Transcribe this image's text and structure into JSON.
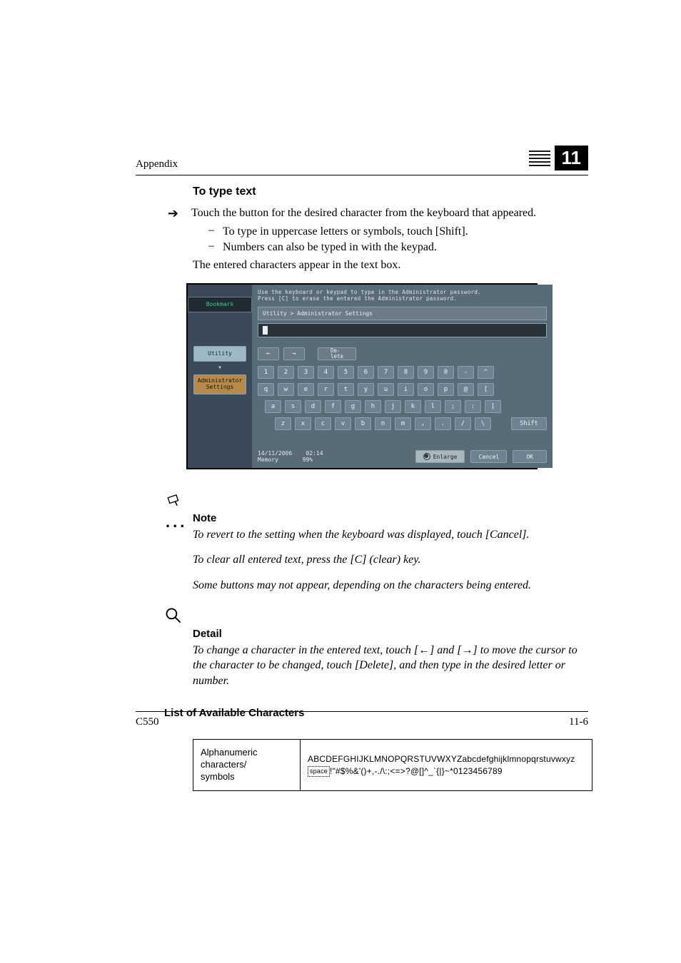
{
  "header": {
    "section": "Appendix",
    "chapter_number": "11"
  },
  "h2": "To type text",
  "step": {
    "arrow": "➔",
    "text": "Touch the button for the desired character from the keyboard that appeared."
  },
  "subs": [
    "To type in uppercase letters or symbols, touch [Shift].",
    "Numbers can also be typed in with the keypad."
  ],
  "after_step": "The entered characters appear in the text box.",
  "touchscreen": {
    "instr1": "Use the keyboard or keypad to type in the Administrator password.",
    "instr2": "Press [C] to erase the entered the Administrator password.",
    "bookmark": "Bookmark",
    "crumb_a": "Utility",
    "crumb_b1": "Administrator",
    "crumb_b2": "Settings",
    "path": "Utility  >  Administrator Settings",
    "arrow_left": "←",
    "arrow_right": "→",
    "delete_label": "De-\nlete",
    "rows": {
      "r1": [
        "1",
        "2",
        "3",
        "4",
        "5",
        "6",
        "7",
        "8",
        "9",
        "0",
        "-",
        "^"
      ],
      "r2": [
        "q",
        "w",
        "e",
        "r",
        "t",
        "y",
        "u",
        "i",
        "o",
        "p",
        "@",
        "["
      ],
      "r3": [
        "a",
        "s",
        "d",
        "f",
        "g",
        "h",
        "j",
        "k",
        "l",
        ";",
        ":",
        "]"
      ],
      "r4": [
        "z",
        "x",
        "c",
        "v",
        "b",
        "n",
        "m",
        ",",
        ".",
        "/",
        "\\"
      ]
    },
    "shift": "Shift",
    "footer_date": "14/11/2006",
    "footer_time": "02:14",
    "footer_mem": "Memory",
    "footer_mem_pct": "99%",
    "btn_enlarge": "Enlarge",
    "btn_cancel": "Cancel",
    "btn_ok": "OK"
  },
  "note": {
    "heading": "Note",
    "p1": "To revert to the setting when the keyboard was displayed, touch [Cancel].",
    "p2": "To clear all entered text, press the [C] (clear) key.",
    "p3": "Some buttons may not appear, depending on the characters being entered."
  },
  "detail": {
    "heading": "Detail",
    "p1_a": "To change a character in the entered text, touch [",
    "p1_b": "] and [",
    "p1_c": "] to move the cursor to the character to be changed, touch [Delete], and then type in the desired letter or number.",
    "left_arrow": "←",
    "right_arrow": "→"
  },
  "list_heading": "List of Available Characters",
  "char_table": {
    "left": "Alphanumeric characters/\nsymbols",
    "line1": "ABCDEFGHIJKLMNOPQRSTUVWXYZabcdefghijklmnopqrstuvwxyz",
    "space_label": "space",
    "line2_rest": "!\"#$%&'()+,-./\\:;<=>?@[]^_`{|}~*0123456789"
  },
  "footer": {
    "left": "C550",
    "right": "11-6"
  }
}
